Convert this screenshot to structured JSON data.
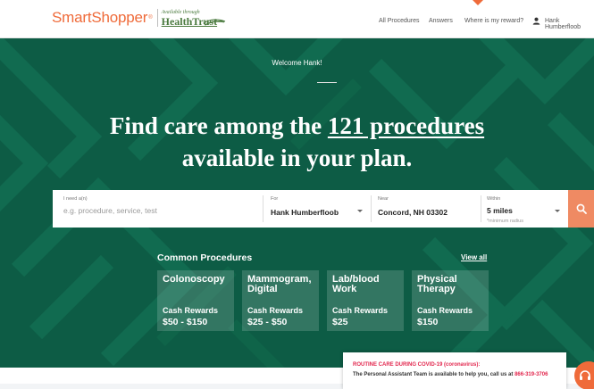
{
  "brand": {
    "name": "SmartShopper",
    "trademark": "®",
    "partner_tagline": "Available through",
    "partner_name": "HealthTrust",
    "primary_color": "#ef6b3a",
    "partner_color": "#4a7a3e"
  },
  "nav": {
    "items": [
      "All Procedures",
      "Answers",
      "Where is my reward?"
    ],
    "user_name": "Hank Humberfloob",
    "user_icon": "user-icon"
  },
  "hero": {
    "background_color": "#0d5c45",
    "welcome": "Welcome Hank!",
    "headline_prefix": "Find care among the ",
    "headline_link": "121 procedures",
    "headline_suffix": "available in your plan."
  },
  "search": {
    "need_label": "I need a(n)",
    "need_placeholder": "e.g. procedure, service, test",
    "need_value": "",
    "for_label": "For",
    "for_value": "Hank Humberfloob",
    "near_label": "Near",
    "near_value": "Concord, NH 03302",
    "within_label": "Within",
    "within_value": "5 miles",
    "within_note": "*minimum radius",
    "button_icon": "search-icon",
    "button_color": "#ef8a63"
  },
  "procedures": {
    "title": "Common Procedures",
    "view_all": "View all",
    "cards": [
      {
        "name": "Colonoscopy",
        "reward_label": "Cash Rewards",
        "amount": "$50 - $150"
      },
      {
        "name": "Mammogram, Digital",
        "reward_label": "Cash Rewards",
        "amount": "$25 - $50"
      },
      {
        "name": "Lab/blood Work",
        "reward_label": "Cash Rewards",
        "amount": "$25"
      },
      {
        "name": "Physical Therapy",
        "reward_label": "Cash Rewards",
        "amount": "$150"
      }
    ]
  },
  "covid_notice": {
    "title": "ROUTINE CARE DURING COVID-19 (coronavirus):",
    "text": "The Personal Assistant Team is available to help you, call us at ",
    "phone": "866-319-3706",
    "accent_color": "#e2264d"
  },
  "chat": {
    "icon": "headset-icon"
  }
}
